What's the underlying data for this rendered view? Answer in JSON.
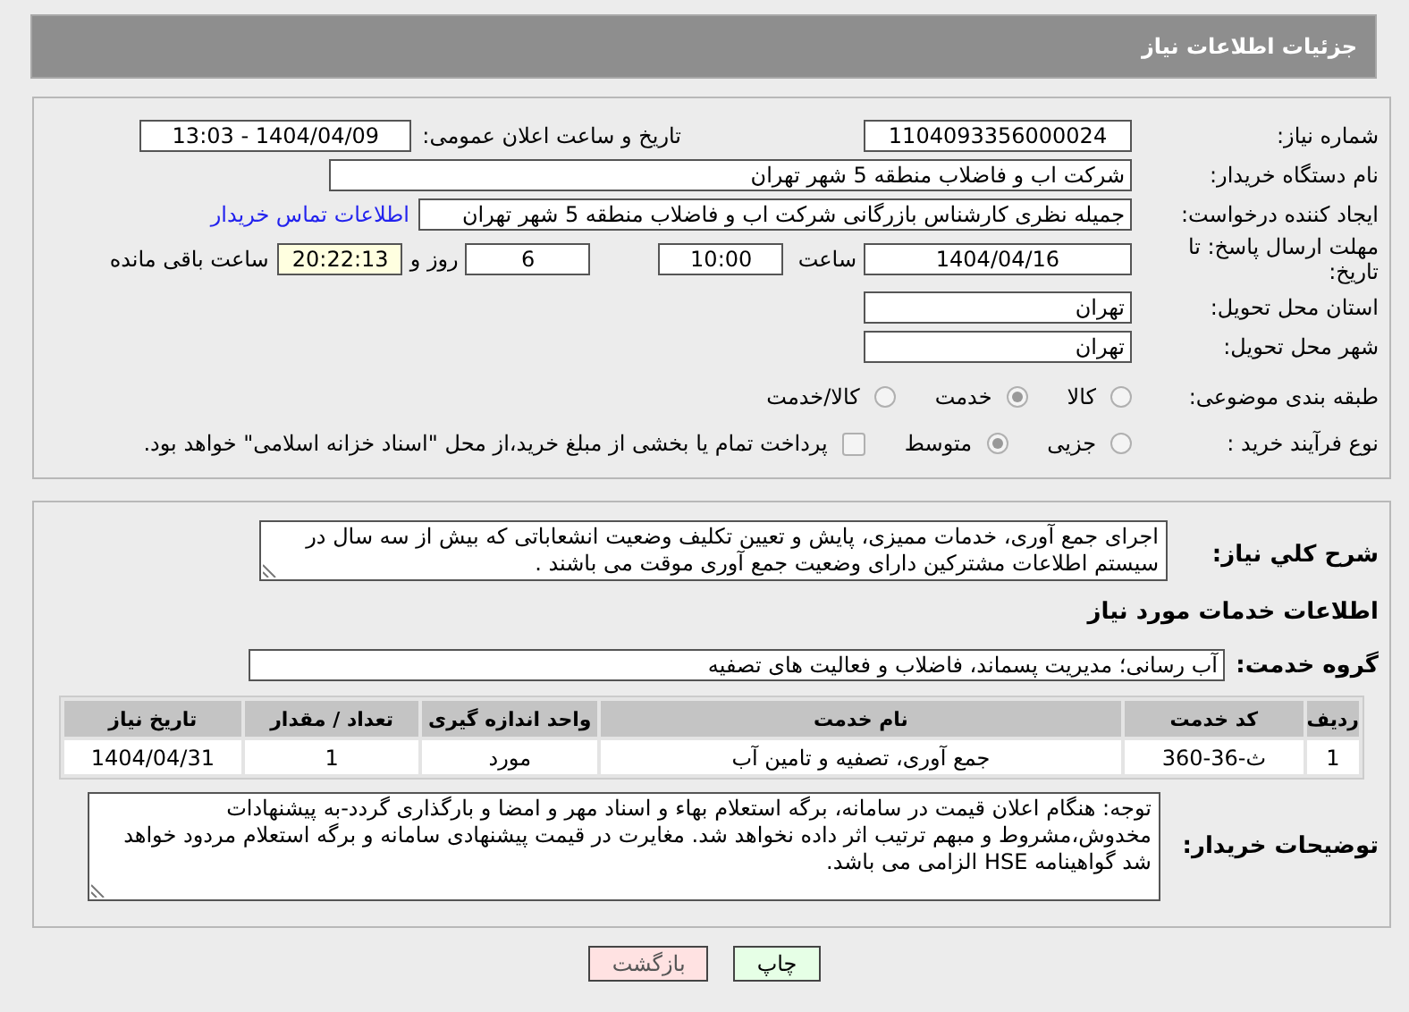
{
  "header": {
    "title": "جزئیات اطلاعات نیاز"
  },
  "need_number": {
    "label": "شماره نیاز:",
    "value": "1104093356000024"
  },
  "announce": {
    "label": "تاریخ و ساعت اعلان عمومی:",
    "value": "1404/04/09 - 13:03"
  },
  "buyer": {
    "label": "نام دستگاه خریدار:",
    "value": "شرکت اب و فاضلاب منطقه 5 شهر تهران"
  },
  "requester": {
    "label": "ایجاد کننده درخواست:",
    "value": "جمیله نظری کارشناس بازرگانی شرکت اب و فاضلاب منطقه 5 شهر تهران",
    "contact_link": "اطلاعات تماس خریدار"
  },
  "deadline": {
    "label": "مهلت ارسال پاسخ: تا تاریخ:",
    "date": "1404/04/16",
    "time_label": "ساعت",
    "time": "10:00",
    "days": "6",
    "days_label": "روز و",
    "remaining": "20:22:13",
    "remaining_label": "ساعت باقی مانده"
  },
  "province": {
    "label": "استان محل تحویل:",
    "value": "تهران"
  },
  "city": {
    "label": "شهر محل تحویل:",
    "value": "تهران"
  },
  "category": {
    "label": "طبقه بندی موضوعی:",
    "options": [
      {
        "label": "کالا",
        "selected": false
      },
      {
        "label": "خدمت",
        "selected": true
      },
      {
        "label": "کالا/خدمت",
        "selected": false
      }
    ]
  },
  "process": {
    "label": "نوع فرآیند خرید :",
    "options": [
      {
        "label": "جزیی",
        "selected": false
      },
      {
        "label": "متوسط",
        "selected": true
      }
    ],
    "payment_note": {
      "label": "پرداخت تمام یا بخشی از مبلغ خرید،از محل \"اسناد خزانه اسلامی\" خواهد بود.",
      "checked": false
    }
  },
  "description": {
    "label": "شرح کلي نياز:",
    "value": "اجرای جمع آوری، خدمات ممیزی، پایش و تعیین تکلیف وضعیت انشعاباتی که بیش از سه  سال در سیستم اطلاعات مشترکین دارای وضعیت جمع آوری موقت می باشند ."
  },
  "services_heading": "اطلاعات خدمات مورد نیاز",
  "service_group": {
    "label": "گروه خدمت:",
    "value": "آب رسانی؛ مدیریت پسماند، فاضلاب و فعالیت های تصفیه"
  },
  "table": {
    "columns": [
      "ردیف",
      "کد خدمت",
      "نام خدمت",
      "واحد اندازه گیری",
      "تعداد / مقدار",
      "تاریخ نیاز"
    ],
    "rows": [
      [
        "1",
        "ث-36-360",
        "جمع آوری، تصفیه و تامین آب",
        "مورد",
        "1",
        "1404/04/31"
      ]
    ]
  },
  "buyer_notes": {
    "label": "توضیحات خریدار:",
    "value": "توجه: هنگام اعلان قیمت در سامانه، برگه استعلام بهاء و اسناد مهر و امضا و بارگذاری گردد-به پیشنهادات مخدوش،مشروط و مبهم ترتیب اثر داده نخواهد شد. مغایرت در قیمت پیشنهادی سامانه و برگه استعلام مردود خواهد شد گواهینامه HSE الزامی می باشد."
  },
  "buttons": [
    {
      "label": "چاپ",
      "kind": "print"
    },
    {
      "label": "بازگشت",
      "kind": "back"
    }
  ]
}
